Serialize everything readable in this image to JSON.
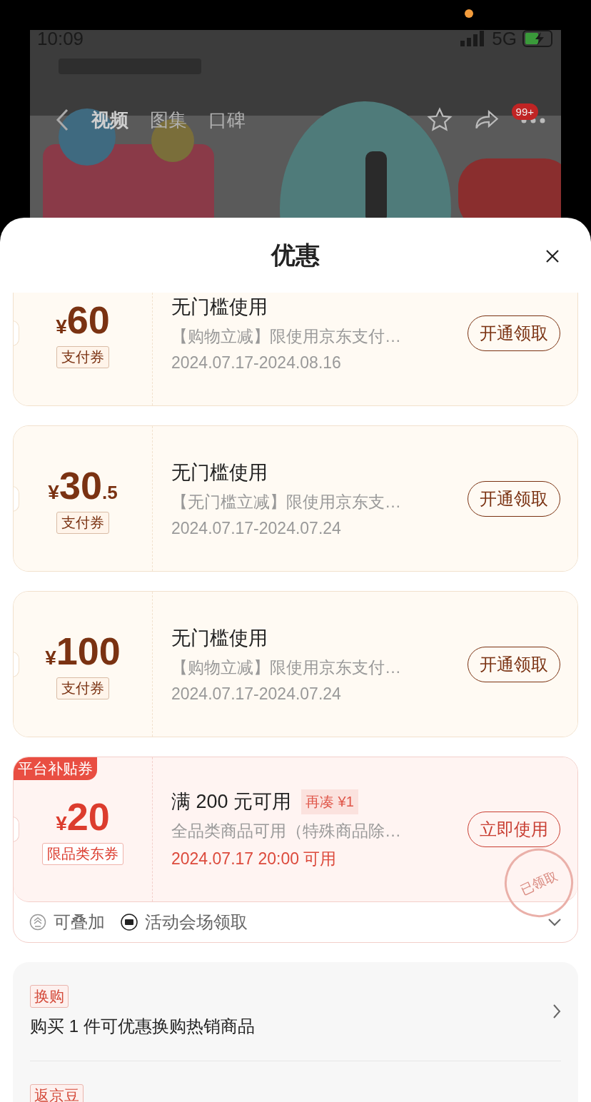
{
  "status_bar": {
    "time": "10:09",
    "network": "5G"
  },
  "nav": {
    "tabs": [
      {
        "label": "视频",
        "selected": true
      },
      {
        "label": "图集",
        "selected": false
      },
      {
        "label": "口碑",
        "selected": false
      }
    ],
    "badge": "99+"
  },
  "sheet": {
    "title": "优惠",
    "coupons": [
      {
        "kind": "pay",
        "symbol": "¥",
        "integer": "60",
        "tag": "支付券",
        "title": "无门槛使用",
        "desc": "【购物立减】限使用京东支付…",
        "date": "2024.07.17-2024.08.16",
        "button": "开通领取"
      },
      {
        "kind": "pay",
        "symbol": "¥",
        "integer": "30",
        "decimal": ".5",
        "tag": "支付券",
        "title": "无门槛使用",
        "desc": "【无门槛立减】限使用京东支…",
        "date": "2024.07.17-2024.07.24",
        "button": "开通领取"
      },
      {
        "kind": "pay",
        "symbol": "¥",
        "integer": "100",
        "tag": "支付券",
        "title": "无门槛使用",
        "desc": "【购物立减】限使用京东支付…",
        "date": "2024.07.17-2024.07.24",
        "button": "开通领取"
      },
      {
        "kind": "platform",
        "corner": "平台补贴券",
        "symbol": "¥",
        "integer": "20",
        "tag": "限品类东券",
        "title": "满 200 元可用",
        "extra": "再凑 ¥1",
        "desc": "全品类商品可用（特殊商品除…",
        "date": "2024.07.17 20:00 可用",
        "button": "立即使用",
        "stamp": "已领取",
        "footer": [
          "可叠加",
          "活动会场领取"
        ]
      }
    ],
    "offers": [
      {
        "tag": "换购",
        "text": "购买 1 件可优惠换购热销商品"
      },
      {
        "tag": "返京豆"
      }
    ]
  }
}
